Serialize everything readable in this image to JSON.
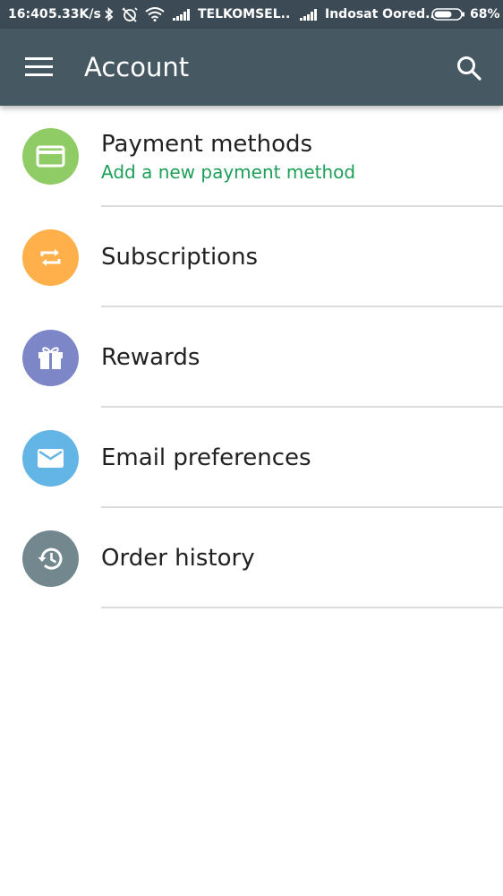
{
  "status_bar": {
    "time": "16:40",
    "speed": "5.33K/s",
    "carrier1": "TELKOMSEL..",
    "carrier2": "Indosat Oored..",
    "battery": "68%",
    "battery_level": 0.68
  },
  "toolbar": {
    "title": "Account",
    "menu_icon": "menu-icon",
    "search_icon": "search-icon"
  },
  "items": [
    {
      "label": "Payment methods",
      "sub": "Add a new payment method",
      "icon": "credit-card-icon",
      "color": "#8fcc66"
    },
    {
      "label": "Subscriptions",
      "icon": "repeat-icon",
      "color": "#ffb04a"
    },
    {
      "label": "Rewards",
      "icon": "gift-icon",
      "color": "#7d87c8"
    },
    {
      "label": "Email preferences",
      "icon": "email-icon",
      "color": "#62b5e5"
    },
    {
      "label": "Order history",
      "icon": "history-icon",
      "color": "#73878f"
    }
  ],
  "colors": {
    "toolbar": "#465861",
    "status_bar": "#3b4a55",
    "accent_green": "#1e9e58"
  }
}
